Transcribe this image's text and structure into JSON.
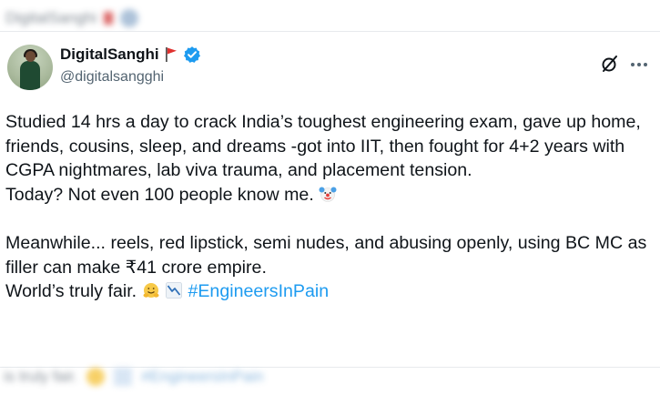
{
  "top_blur": {
    "text": "DigitalSanghi"
  },
  "tweet": {
    "author": {
      "display_name": "DigitalSanghi",
      "handle": "@digitalsangghi",
      "flag_icon": "red-flag-icon",
      "verified_icon": "verified-badge-icon",
      "verified_color": "#1d9bf0"
    },
    "actions": {
      "grok_icon": "grok-icon",
      "more_icon": "more-options-icon"
    },
    "paragraphs": [
      "Studied 14 hrs a day to crack India’s toughest engineering exam, gave up home, friends, cousins, sleep, and dreams -got into IIT, then fought for 4+2 years with CGPA nightmares, lab viva trauma, and placement tension.",
      "Today? Not even 100 people know me.",
      "Meanwhile... reels, red lipstick, semi nudes, and abusing openly, using BC MC as filler can make  ₹41 crore empire.",
      "World’s truly fair."
    ],
    "hashtag": "#EngineersInPain",
    "hashtag_color": "#1d9bf0",
    "emojis": [
      "clown-face-emoji",
      "hugging-face-emoji",
      "chart-decreasing-emoji"
    ]
  },
  "bottom_blur": {
    "text": "is truly fair.",
    "hashtag": "#EngineersInPain"
  }
}
